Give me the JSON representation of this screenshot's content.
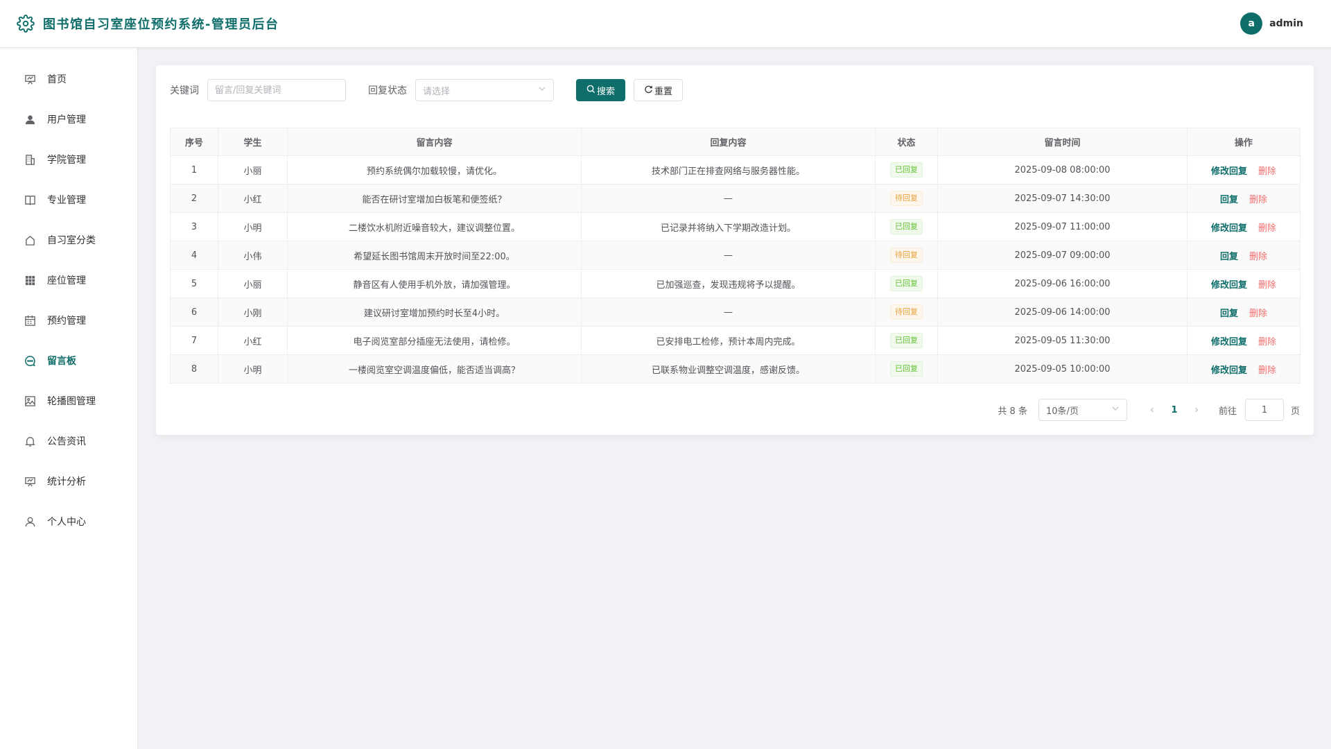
{
  "app": {
    "title": "图书馆自习室座位预约系统-管理员后台"
  },
  "user": {
    "avatar_letter": "a",
    "name": "admin"
  },
  "colors": {
    "primary": "#0f6e6a",
    "success": "#67c23a",
    "warning": "#e6a23c",
    "danger": "#f56c6c"
  },
  "sidebar": {
    "items": [
      {
        "label": "首页",
        "icon": "home-icon",
        "active": false
      },
      {
        "label": "用户管理",
        "icon": "user-icon",
        "active": false
      },
      {
        "label": "学院管理",
        "icon": "building-icon",
        "active": false
      },
      {
        "label": "专业管理",
        "icon": "book-icon",
        "active": false
      },
      {
        "label": "自习室分类",
        "icon": "house-icon",
        "active": false
      },
      {
        "label": "座位管理",
        "icon": "grid-icon",
        "active": false
      },
      {
        "label": "预约管理",
        "icon": "calendar-icon",
        "active": false
      },
      {
        "label": "留言板",
        "icon": "chat-icon",
        "active": true
      },
      {
        "label": "轮播图管理",
        "icon": "image-icon",
        "active": false
      },
      {
        "label": "公告资讯",
        "icon": "bell-icon",
        "active": false
      },
      {
        "label": "统计分析",
        "icon": "chart-icon",
        "active": false
      },
      {
        "label": "个人中心",
        "icon": "person-icon",
        "active": false
      }
    ]
  },
  "filters": {
    "keyword_label": "关键词",
    "keyword_placeholder": "留言/回复关键词",
    "keyword_value": "",
    "status_label": "回复状态",
    "status_placeholder": "请选择",
    "search_label": "搜索",
    "reset_label": "重置"
  },
  "table": {
    "headers": [
      "序号",
      "学生",
      "留言内容",
      "回复内容",
      "状态",
      "留言时间",
      "操作"
    ],
    "rows": [
      {
        "no": "1",
        "student": "小丽",
        "content": "预约系统偶尔加载较慢，请优化。",
        "reply": "技术部门正在排查网络与服务器性能。",
        "status": "已回复",
        "replied": true,
        "time": "2025-09-08 08:00:00",
        "action": "修改回复",
        "delete": "删除"
      },
      {
        "no": "2",
        "student": "小红",
        "content": "能否在研讨室增加白板笔和便签纸？",
        "reply": "—",
        "status": "待回复",
        "replied": false,
        "time": "2025-09-07 14:30:00",
        "action": "回复",
        "delete": "删除"
      },
      {
        "no": "3",
        "student": "小明",
        "content": "二楼饮水机附近噪音较大，建议调整位置。",
        "reply": "已记录并将纳入下学期改造计划。",
        "status": "已回复",
        "replied": true,
        "time": "2025-09-07 11:00:00",
        "action": "修改回复",
        "delete": "删除"
      },
      {
        "no": "4",
        "student": "小伟",
        "content": "希望延长图书馆周末开放时间至22:00。",
        "reply": "—",
        "status": "待回复",
        "replied": false,
        "time": "2025-09-07 09:00:00",
        "action": "回复",
        "delete": "删除"
      },
      {
        "no": "5",
        "student": "小丽",
        "content": "静音区有人使用手机外放，请加强管理。",
        "reply": "已加强巡查，发现违规将予以提醒。",
        "status": "已回复",
        "replied": true,
        "time": "2025-09-06 16:00:00",
        "action": "修改回复",
        "delete": "删除"
      },
      {
        "no": "6",
        "student": "小刚",
        "content": "建议研讨室增加预约时长至4小时。",
        "reply": "—",
        "status": "待回复",
        "replied": false,
        "time": "2025-09-06 14:00:00",
        "action": "回复",
        "delete": "删除"
      },
      {
        "no": "7",
        "student": "小红",
        "content": "电子阅览室部分插座无法使用，请检修。",
        "reply": "已安排电工检修，预计本周内完成。",
        "status": "已回复",
        "replied": true,
        "time": "2025-09-05 11:30:00",
        "action": "修改回复",
        "delete": "删除"
      },
      {
        "no": "8",
        "student": "小明",
        "content": "一楼阅览室空调温度偏低，能否适当调高？",
        "reply": "已联系物业调整空调温度，感谢反馈。",
        "status": "已回复",
        "replied": true,
        "time": "2025-09-05 10:00:00",
        "action": "修改回复",
        "delete": "删除"
      }
    ]
  },
  "pagination": {
    "total_text": "共 8 条",
    "page_size": "10条/页",
    "current_page": "1",
    "goto_label": "前往",
    "goto_value": "1",
    "page_suffix": "页"
  }
}
